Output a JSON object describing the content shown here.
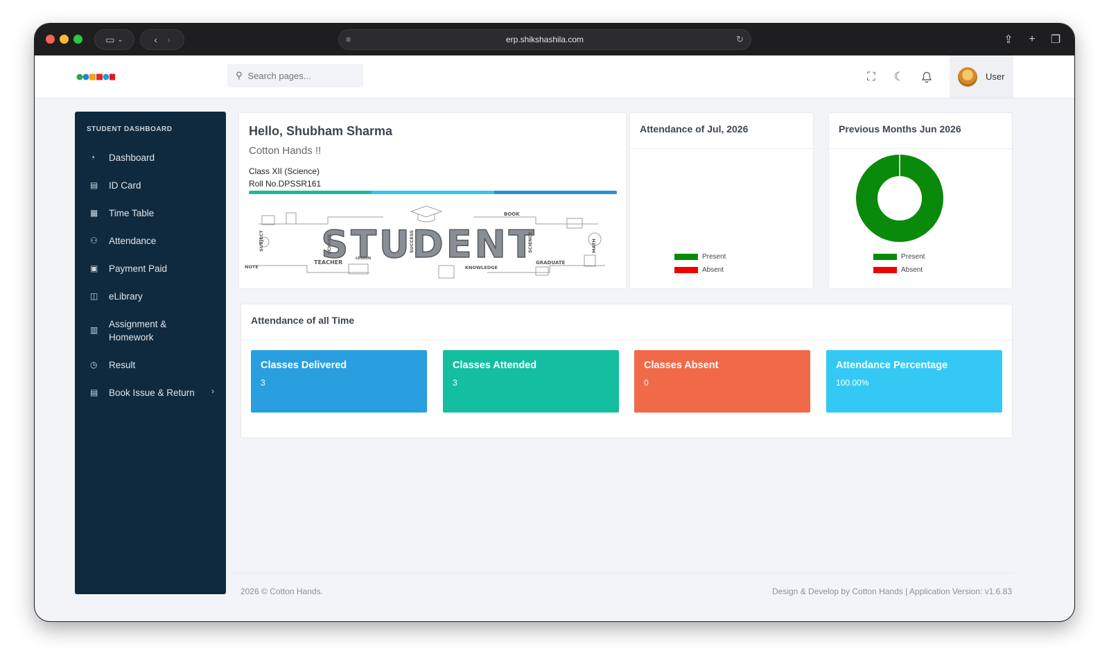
{
  "browser": {
    "url": "erp.shikshashila.com"
  },
  "header": {
    "logo_text": "COTTON",
    "search_placeholder": "Search pages...",
    "user_name": "User",
    "icons": [
      "fullscreen-icon",
      "moon-icon",
      "bell-icon"
    ]
  },
  "sidebar": {
    "title": "STUDENT DASHBOARD",
    "items": [
      {
        "label": "Dashboard",
        "icon": "gauge-icon"
      },
      {
        "label": "ID Card",
        "icon": "id-card-icon"
      },
      {
        "label": "Time Table",
        "icon": "calendar-icon"
      },
      {
        "label": "Attendance",
        "icon": "people-icon"
      },
      {
        "label": "Payment Paid",
        "icon": "wallet-icon"
      },
      {
        "label": "eLibrary",
        "icon": "book-open-icon"
      },
      {
        "label": "Assignment & Homework",
        "icon": "notebook-icon"
      },
      {
        "label": "Result",
        "icon": "pie-icon"
      },
      {
        "label": "Book Issue & Return",
        "icon": "list-book-icon"
      }
    ]
  },
  "hello": {
    "title": "Hello, Shubham Sharma",
    "subtitle": "Cotton Hands !!",
    "class": "Class XII (Science)",
    "roll": "Roll No.DPSSR161",
    "progress_colors": [
      "#1bbc9b",
      "#35c4f0",
      "#2a8fd9"
    ],
    "banner_word": "STUDENT",
    "banner_tags": [
      "SUBJECT",
      "SCHOOL",
      "SUCCESS",
      "SCIENCE",
      "MATH",
      "NOTE",
      "TEACHER",
      "LESSON",
      "KNOWLEDGE",
      "GRADUATE",
      "BOOK"
    ]
  },
  "attendance_month": {
    "title": "Attendance of Jul, 2026",
    "legend": [
      {
        "label": "Present",
        "color": "#0a8a0a"
      },
      {
        "label": "Absent",
        "color": "#f00000"
      }
    ]
  },
  "previous_month": {
    "title": "Previous Months Jun 2026",
    "legend": [
      {
        "label": "Present",
        "color": "#0a8a0a"
      },
      {
        "label": "Absent",
        "color": "#f00000"
      }
    ],
    "chart_data": {
      "type": "pie",
      "categories": [
        "Present",
        "Absent"
      ],
      "values": [
        100,
        0
      ]
    }
  },
  "all_time": {
    "title": "Attendance of all Time",
    "stats": [
      {
        "title": "Classes Delivered",
        "value": "3",
        "color": "#2a9fe0"
      },
      {
        "title": "Classes Attended",
        "value": "3",
        "color": "#14bfa0"
      },
      {
        "title": "Classes Absent",
        "value": "0",
        "color": "#f06a4a"
      },
      {
        "title": "Attendance Percentage",
        "value": "100.00%",
        "color": "#34c9f5"
      }
    ]
  },
  "footer": {
    "left": "2026 © Cotton Hands.",
    "right": "Design & Develop by Cotton Hands | Application Version: v1.6.83"
  }
}
